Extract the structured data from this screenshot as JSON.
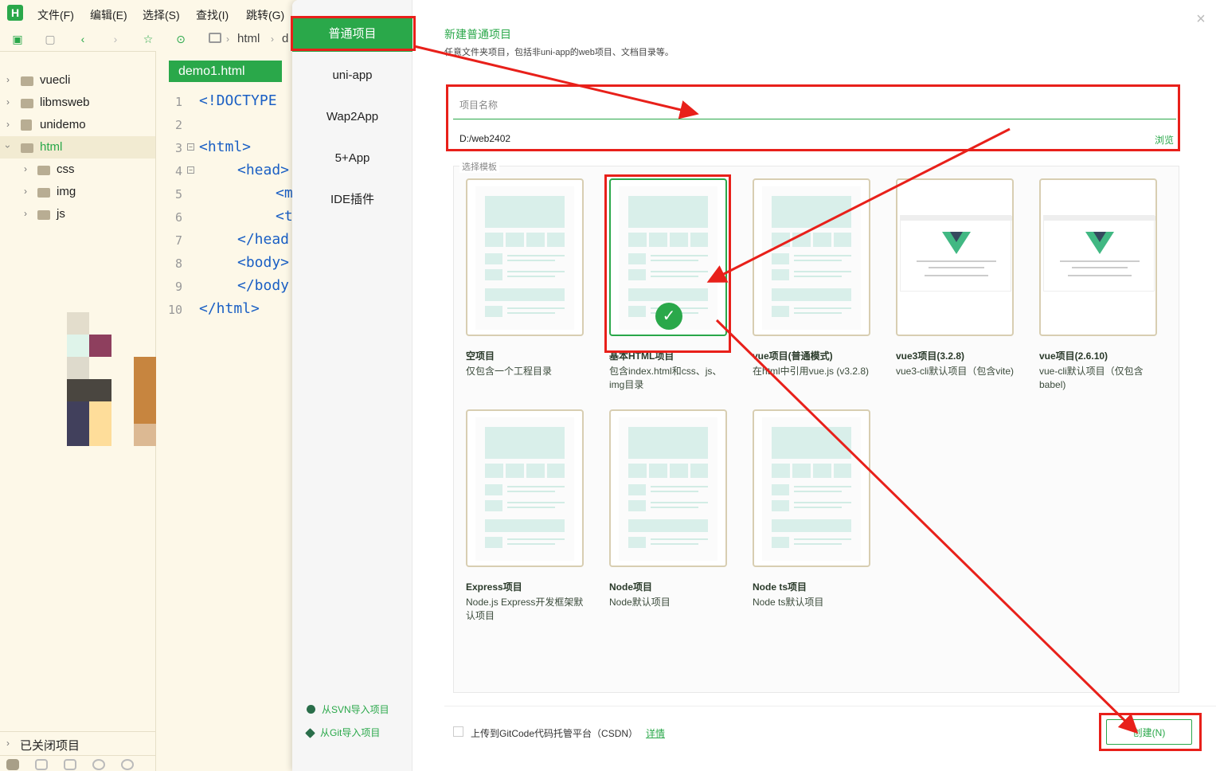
{
  "app": {
    "logo": "H"
  },
  "menu": [
    "文件(F)",
    "编辑(E)",
    "选择(S)",
    "查找(I)",
    "跳转(G)"
  ],
  "toolbar_icons": [
    "new-file-icon",
    "save-icon",
    "back-icon",
    "forward-icon",
    "star-icon",
    "run-icon"
  ],
  "breadcrumb": [
    "html",
    "d"
  ],
  "explorer": {
    "items": [
      {
        "label": "vuecli",
        "expanded": false
      },
      {
        "label": "libmsweb",
        "expanded": false
      },
      {
        "label": "unidemo",
        "expanded": false
      },
      {
        "label": "html",
        "expanded": true
      },
      {
        "label": "css",
        "expanded": false
      },
      {
        "label": "img",
        "expanded": false
      },
      {
        "label": "js",
        "expanded": false
      }
    ],
    "closed_projects": "已关闭项目"
  },
  "editor": {
    "tab": "demo1.html",
    "lines": [
      {
        "n": "1",
        "code": "<!DOCTYPE"
      },
      {
        "n": "2",
        "code": ""
      },
      {
        "n": "3",
        "code": "<html>"
      },
      {
        "n": "4",
        "code": "<head>"
      },
      {
        "n": "5",
        "code": "<m"
      },
      {
        "n": "6",
        "code": "<t"
      },
      {
        "n": "7",
        "code": "</head"
      },
      {
        "n": "8",
        "code": "<body>"
      },
      {
        "n": "9",
        "code": "</body"
      },
      {
        "n": "10",
        "code": "</html>"
      }
    ]
  },
  "dialog": {
    "nav": [
      "普通项目",
      "uni-app",
      "Wap2App",
      "5+App",
      "IDE插件"
    ],
    "active_nav": "普通项目",
    "import_svn": "从SVN导入项目",
    "import_git": "从Git导入项目",
    "title": "新建普通项目",
    "subtitle": "任意文件夹项目，包括非uni-app的web项目、文档目录等。",
    "name_placeholder": "项目名称",
    "name_value": "",
    "path": "D:/web2402",
    "browse": "浏览",
    "template_legend": "选择模板",
    "templates": [
      {
        "name": "空项目",
        "desc": "仅包含一个工程目录",
        "kind": "generic",
        "selected": false
      },
      {
        "name": "基本HTML项目",
        "desc": "包含index.html和css、js、img目录",
        "kind": "generic",
        "selected": true
      },
      {
        "name": "vue项目(普通模式)",
        "desc": "在html中引用vue.js (v3.2.8)",
        "kind": "generic",
        "selected": false
      },
      {
        "name": "vue3项目(3.2.8)",
        "desc": "vue3-cli默认项目（包含vite)",
        "kind": "vue",
        "selected": false
      },
      {
        "name": "vue项目(2.6.10)",
        "desc": "vue-cli默认项目（仅包含babel)",
        "kind": "vue",
        "selected": false
      },
      {
        "name": "Express项目",
        "desc": "Node.js Express开发框架默认项目",
        "kind": "generic",
        "selected": false
      },
      {
        "name": "Node项目",
        "desc": "Node默认项目",
        "kind": "generic",
        "selected": false
      },
      {
        "name": "Node ts项目",
        "desc": "Node ts默认项目",
        "kind": "generic",
        "selected": false
      }
    ],
    "gitcode_label": "上传到GitCode代码托管平台（CSDN）",
    "gitcode_checked": false,
    "gitcode_detail": "详情",
    "create_button": "创建(N)",
    "close_icon": "close-icon"
  },
  "colors": {
    "accent": "#2aa84a",
    "annotation": "#e8201a",
    "background": "#fdf8e8"
  }
}
